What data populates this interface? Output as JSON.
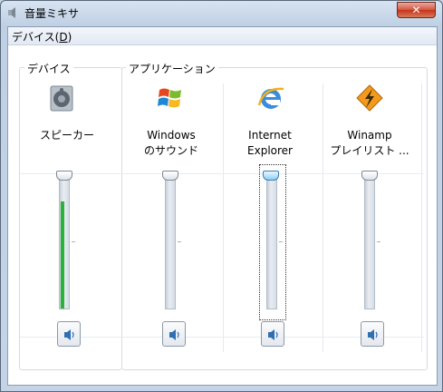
{
  "window": {
    "title": "音量ミキサ",
    "close_glyph": "✕"
  },
  "menu": {
    "device_label": "デバイス(",
    "device_accel": "D",
    "device_suffix": ")"
  },
  "groups": {
    "device_group_label": "デバイス",
    "apps_group_label": "アプリケーション"
  },
  "channels": [
    {
      "icon": "speaker-icon",
      "line1": "スピーカー",
      "line2": "",
      "level": 1.0,
      "meter": 0.8,
      "active": false
    },
    {
      "icon": "windows-logo-icon",
      "line1": "Windows",
      "line2": "のサウンド",
      "level": 1.0,
      "active": false
    },
    {
      "icon": "internet-explorer-icon",
      "line1": "Internet",
      "line2": "Explorer",
      "level": 1.0,
      "active": true
    },
    {
      "icon": "winamp-icon",
      "line1": "Winamp",
      "line2": "プレイリスト ...",
      "level": 1.0,
      "active": false
    }
  ],
  "colors": {
    "meter_green": "#28b43a",
    "active_thumb": "#8fd0f7"
  }
}
